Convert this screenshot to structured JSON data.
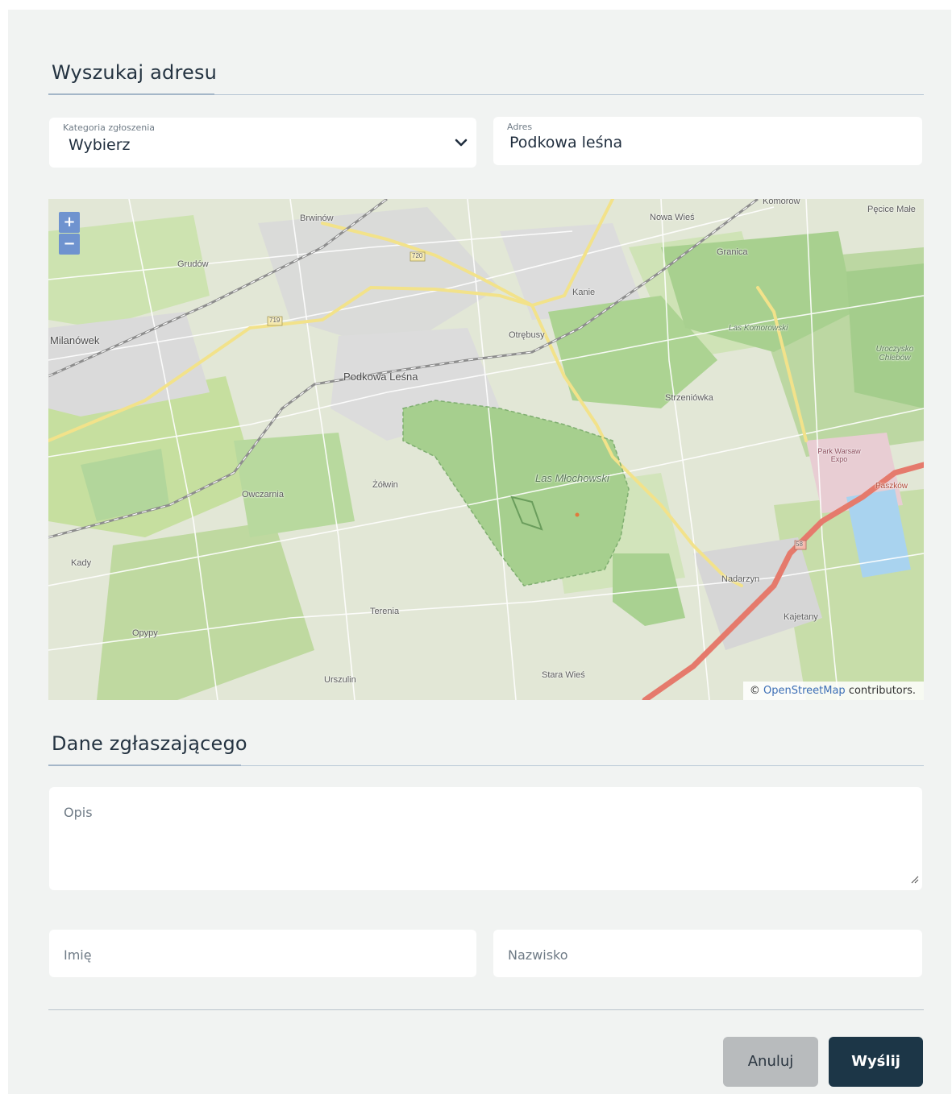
{
  "address_section": {
    "title": "Wyszukaj adresu",
    "category": {
      "label": "Kategoria zgłoszenia",
      "value": "Wybierz"
    },
    "address": {
      "label": "Adres",
      "value": "Podkowa leśna"
    }
  },
  "map": {
    "zoom_in": "+",
    "zoom_out": "−",
    "attribution_prefix": "©",
    "attribution_link": "OpenStreetMap",
    "attribution_suffix": "contributors.",
    "places": {
      "brwinow": "Brwinów",
      "grudow": "Grudów",
      "milanowek": "Milanówek",
      "podkowa": "Podkowa Leśna",
      "owczarnia": "Owczarnia",
      "zolwin": "Żółwin",
      "kady": "Kady",
      "opypy": "Opypy",
      "terenia": "Terenia",
      "urszulin": "Urszulin",
      "stara_wies": "Stara Wieś",
      "las_mlochowski": "Las Młochowski",
      "nowa_wies": "Nowa Wieś",
      "komorow": "Komorów",
      "pecice_male": "Pęcice Małe",
      "granica": "Granica",
      "kanie": "Kanie",
      "otrebusy": "Otrębusy",
      "las_komorowski": "Las Komorowski",
      "uroczysko": "Uroczysko Chlebów",
      "strzeniowka": "Strzeniówka",
      "park_expo": "Park Warsaw Expo",
      "paszkow": "Paszków",
      "nadarzyn": "Nadarzyn",
      "kajetany": "Kajetany",
      "road_720": "720",
      "road_719": "719",
      "road_58": "58"
    }
  },
  "reporter_section": {
    "title": "Dane zgłaszającego",
    "description_placeholder": "Opis",
    "first_name_placeholder": "Imię",
    "last_name_placeholder": "Nazwisko"
  },
  "actions": {
    "cancel": "Anuluj",
    "send": "Wyślij"
  },
  "colors": {
    "primary_button": "#1c3647",
    "secondary_button": "#b8bbbd",
    "background": "#f1f3f2"
  }
}
